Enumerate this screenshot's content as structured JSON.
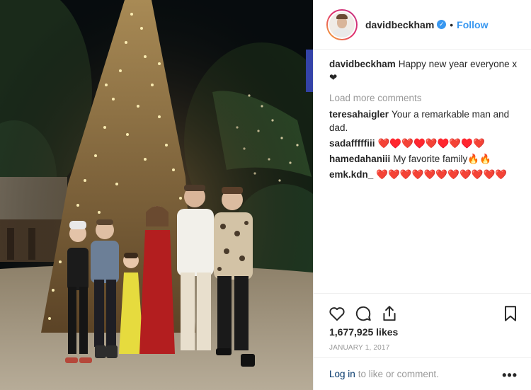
{
  "post": {
    "username": "davidbeckham",
    "follow_label": "Follow",
    "separator": "•",
    "verified_glyph": "✓",
    "caption_user": "davidbeckham",
    "caption_text": "Happy new year everyone x ❤",
    "load_more_label": "Load more comments",
    "comments": [
      {
        "user": "teresahaigler",
        "text": "Your a remarkable man and dad."
      },
      {
        "user": "sadafffffiii",
        "text": "❤️♥️❤️♥️❤️♥️❤️♥️❤️"
      },
      {
        "user": "hamedahaniii",
        "text": "My favorite family🔥🔥"
      },
      {
        "user": "emk.kdn_",
        "text": "❤️❤️❤️❤️❤️❤️❤️❤️❤️❤️❤️"
      }
    ],
    "likes": "1,677,925 likes",
    "date": "JANUARY 1, 2017",
    "login_link": "Log in",
    "login_suffix": "to like or comment.",
    "more_options_glyph": "•••",
    "icons": [
      "heart-icon",
      "comment-icon",
      "share-icon",
      "bookmark-icon",
      "verified-badge-icon",
      "more-options-icon"
    ]
  },
  "colors": {
    "accent": "#3897f0",
    "text": "#262626",
    "muted": "#999999",
    "link": "#003569",
    "divider": "#efefef"
  }
}
